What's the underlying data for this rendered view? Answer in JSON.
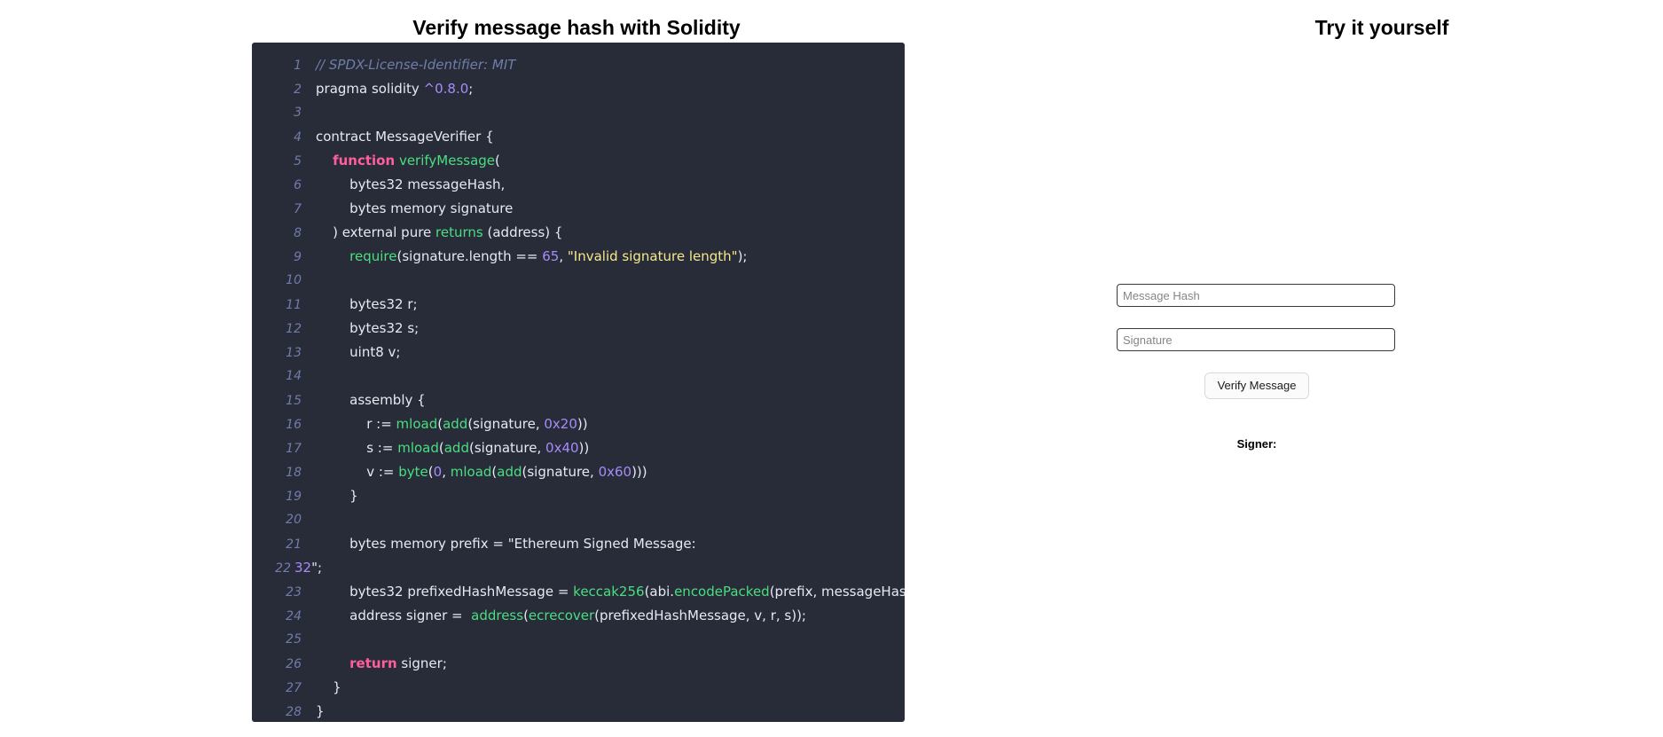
{
  "headings": {
    "left": "Verify message hash with Solidity",
    "right": "Try it yourself"
  },
  "code": {
    "language": "solidity",
    "background": "#282c39",
    "lines": [
      {
        "n": "1",
        "wrapped": false,
        "tokens": [
          {
            "t": "// SPDX-License-Identifier: MIT",
            "c": "comment"
          }
        ]
      },
      {
        "n": "2",
        "wrapped": false,
        "tokens": [
          {
            "t": "pragma solidity ",
            "c": "plain"
          },
          {
            "t": "^0.8.0",
            "c": "num"
          },
          {
            "t": ";",
            "c": "plain"
          }
        ]
      },
      {
        "n": "3",
        "wrapped": false,
        "tokens": []
      },
      {
        "n": "4",
        "wrapped": false,
        "tokens": [
          {
            "t": "contract MessageVerifier {",
            "c": "plain"
          }
        ]
      },
      {
        "n": "5",
        "wrapped": false,
        "tokens": [
          {
            "t": "    ",
            "c": "plain"
          },
          {
            "t": "function",
            "c": "kw"
          },
          {
            "t": " ",
            "c": "plain"
          },
          {
            "t": "verifyMessage",
            "c": "fn"
          },
          {
            "t": "(",
            "c": "plain"
          }
        ]
      },
      {
        "n": "6",
        "wrapped": false,
        "tokens": [
          {
            "t": "        bytes32 messageHash,",
            "c": "plain"
          }
        ]
      },
      {
        "n": "7",
        "wrapped": false,
        "tokens": [
          {
            "t": "        bytes memory signature",
            "c": "plain"
          }
        ]
      },
      {
        "n": "8",
        "wrapped": false,
        "tokens": [
          {
            "t": "    ) external pure ",
            "c": "plain"
          },
          {
            "t": "returns",
            "c": "kw2"
          },
          {
            "t": " (address) {",
            "c": "plain"
          }
        ]
      },
      {
        "n": "9",
        "wrapped": false,
        "tokens": [
          {
            "t": "        ",
            "c": "plain"
          },
          {
            "t": "require",
            "c": "fn"
          },
          {
            "t": "(signature.length == ",
            "c": "plain"
          },
          {
            "t": "65",
            "c": "num"
          },
          {
            "t": ", ",
            "c": "plain"
          },
          {
            "t": "\"Invalid signature length\"",
            "c": "str"
          },
          {
            "t": ");",
            "c": "plain"
          }
        ]
      },
      {
        "n": "10",
        "wrapped": false,
        "tokens": []
      },
      {
        "n": "11",
        "wrapped": false,
        "tokens": [
          {
            "t": "        bytes32 r;",
            "c": "plain"
          }
        ]
      },
      {
        "n": "12",
        "wrapped": false,
        "tokens": [
          {
            "t": "        bytes32 s;",
            "c": "plain"
          }
        ]
      },
      {
        "n": "13",
        "wrapped": false,
        "tokens": [
          {
            "t": "        uint8 v;",
            "c": "plain"
          }
        ]
      },
      {
        "n": "14",
        "wrapped": false,
        "tokens": []
      },
      {
        "n": "15",
        "wrapped": false,
        "tokens": [
          {
            "t": "        assembly {",
            "c": "plain"
          }
        ]
      },
      {
        "n": "16",
        "wrapped": false,
        "tokens": [
          {
            "t": "            r := ",
            "c": "plain"
          },
          {
            "t": "mload",
            "c": "fn"
          },
          {
            "t": "(",
            "c": "plain"
          },
          {
            "t": "add",
            "c": "fn"
          },
          {
            "t": "(signature, ",
            "c": "plain"
          },
          {
            "t": "0x20",
            "c": "num"
          },
          {
            "t": "))",
            "c": "plain"
          }
        ]
      },
      {
        "n": "17",
        "wrapped": false,
        "tokens": [
          {
            "t": "            s := ",
            "c": "plain"
          },
          {
            "t": "mload",
            "c": "fn"
          },
          {
            "t": "(",
            "c": "plain"
          },
          {
            "t": "add",
            "c": "fn"
          },
          {
            "t": "(signature, ",
            "c": "plain"
          },
          {
            "t": "0x40",
            "c": "num"
          },
          {
            "t": "))",
            "c": "plain"
          }
        ]
      },
      {
        "n": "18",
        "wrapped": false,
        "tokens": [
          {
            "t": "            v := ",
            "c": "plain"
          },
          {
            "t": "byte",
            "c": "fn"
          },
          {
            "t": "(",
            "c": "plain"
          },
          {
            "t": "0",
            "c": "num"
          },
          {
            "t": ", ",
            "c": "plain"
          },
          {
            "t": "mload",
            "c": "fn"
          },
          {
            "t": "(",
            "c": "plain"
          },
          {
            "t": "add",
            "c": "fn"
          },
          {
            "t": "(signature, ",
            "c": "plain"
          },
          {
            "t": "0x60",
            "c": "num"
          },
          {
            "t": ")))",
            "c": "plain"
          }
        ]
      },
      {
        "n": "19",
        "wrapped": false,
        "tokens": [
          {
            "t": "        }",
            "c": "plain"
          }
        ]
      },
      {
        "n": "20",
        "wrapped": false,
        "tokens": []
      },
      {
        "n": "21",
        "wrapped": false,
        "tokens": [
          {
            "t": "        bytes memory prefix = ",
            "c": "plain"
          },
          {
            "t": "\"\u0019Ethereum Signed Message:",
            "c": "plain"
          }
        ]
      },
      {
        "n": "22",
        "wrapped": true,
        "tokens": [
          {
            "t": "32",
            "c": "num"
          },
          {
            "t": "\";",
            "c": "plain"
          }
        ]
      },
      {
        "n": "23",
        "wrapped": false,
        "tokens": [
          {
            "t": "        bytes32 prefixedHashMessage = ",
            "c": "plain"
          },
          {
            "t": "keccak256",
            "c": "fn"
          },
          {
            "t": "(abi.",
            "c": "plain"
          },
          {
            "t": "encodePacked",
            "c": "fn"
          },
          {
            "t": "(prefix, messageHash));",
            "c": "plain"
          }
        ]
      },
      {
        "n": "24",
        "wrapped": false,
        "tokens": [
          {
            "t": "        address signer =  ",
            "c": "plain"
          },
          {
            "t": "address",
            "c": "fn"
          },
          {
            "t": "(",
            "c": "plain"
          },
          {
            "t": "ecrecover",
            "c": "fn"
          },
          {
            "t": "(prefixedHashMessage, v, r, s));",
            "c": "plain"
          }
        ]
      },
      {
        "n": "25",
        "wrapped": false,
        "tokens": []
      },
      {
        "n": "26",
        "wrapped": false,
        "tokens": [
          {
            "t": "        ",
            "c": "plain"
          },
          {
            "t": "return",
            "c": "kw"
          },
          {
            "t": " signer;",
            "c": "plain"
          }
        ]
      },
      {
        "n": "27",
        "wrapped": false,
        "tokens": [
          {
            "t": "    }",
            "c": "plain"
          }
        ]
      },
      {
        "n": "28",
        "wrapped": false,
        "tokens": [
          {
            "t": "}",
            "c": "plain"
          }
        ]
      }
    ]
  },
  "form": {
    "message_hash": {
      "value": "",
      "placeholder": "Message Hash"
    },
    "signature": {
      "value": "",
      "placeholder": "Signature"
    },
    "verify_button": "Verify Message",
    "signer_label": "Signer:",
    "signer_value": ""
  },
  "colors": {
    "code_background": "#282c39",
    "line_number": "#6f7da8",
    "code_default": "#e6e9f0",
    "keyword": "#ff5e9c",
    "function": "#4ade80",
    "number": "#a78bfa",
    "string": "#f5e98c",
    "comment": "#6f7da8",
    "page_background": "#ffffff"
  }
}
